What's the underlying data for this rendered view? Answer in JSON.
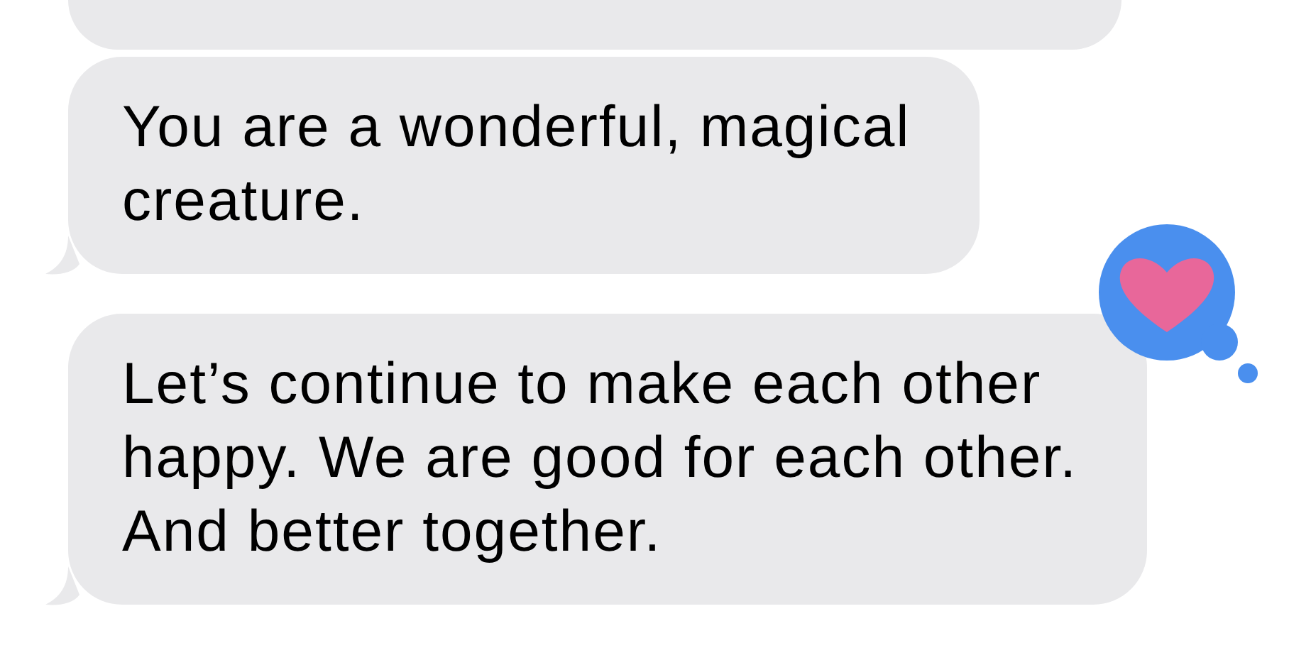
{
  "messages": [
    {
      "tail": false
    },
    {
      "text": "You are a wonderful, magical creature.",
      "tail": true
    },
    {
      "text": "Let’s continue to make each other happy. We are good for each other. And better together.",
      "tail": true,
      "reaction": {
        "kind": "heart"
      }
    }
  ]
}
